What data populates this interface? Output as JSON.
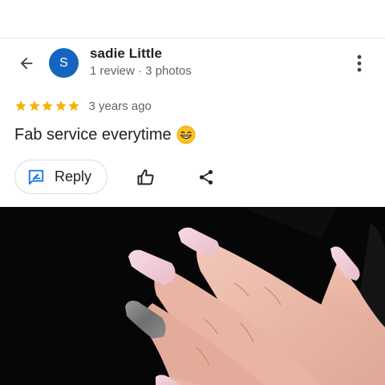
{
  "review": {
    "user": {
      "avatar_letter": "S",
      "avatar_color": "#1565c0",
      "name": "sadie Little",
      "meta": "1 review · 3 photos"
    },
    "rating": 5,
    "star_color": "#f4b400",
    "date": "3 years ago",
    "text": "Fab service everytime",
    "emoji": "grinning-face-emoji"
  },
  "actions": {
    "reply_label": "Reply",
    "reply_icon": "rate-review-icon",
    "like_icon": "thumb-up-icon",
    "share_icon": "share-icon",
    "back_icon": "arrow-back-icon",
    "more_icon": "more-vert-icon"
  },
  "photo": {
    "subject": "manicured-nails-photo"
  }
}
